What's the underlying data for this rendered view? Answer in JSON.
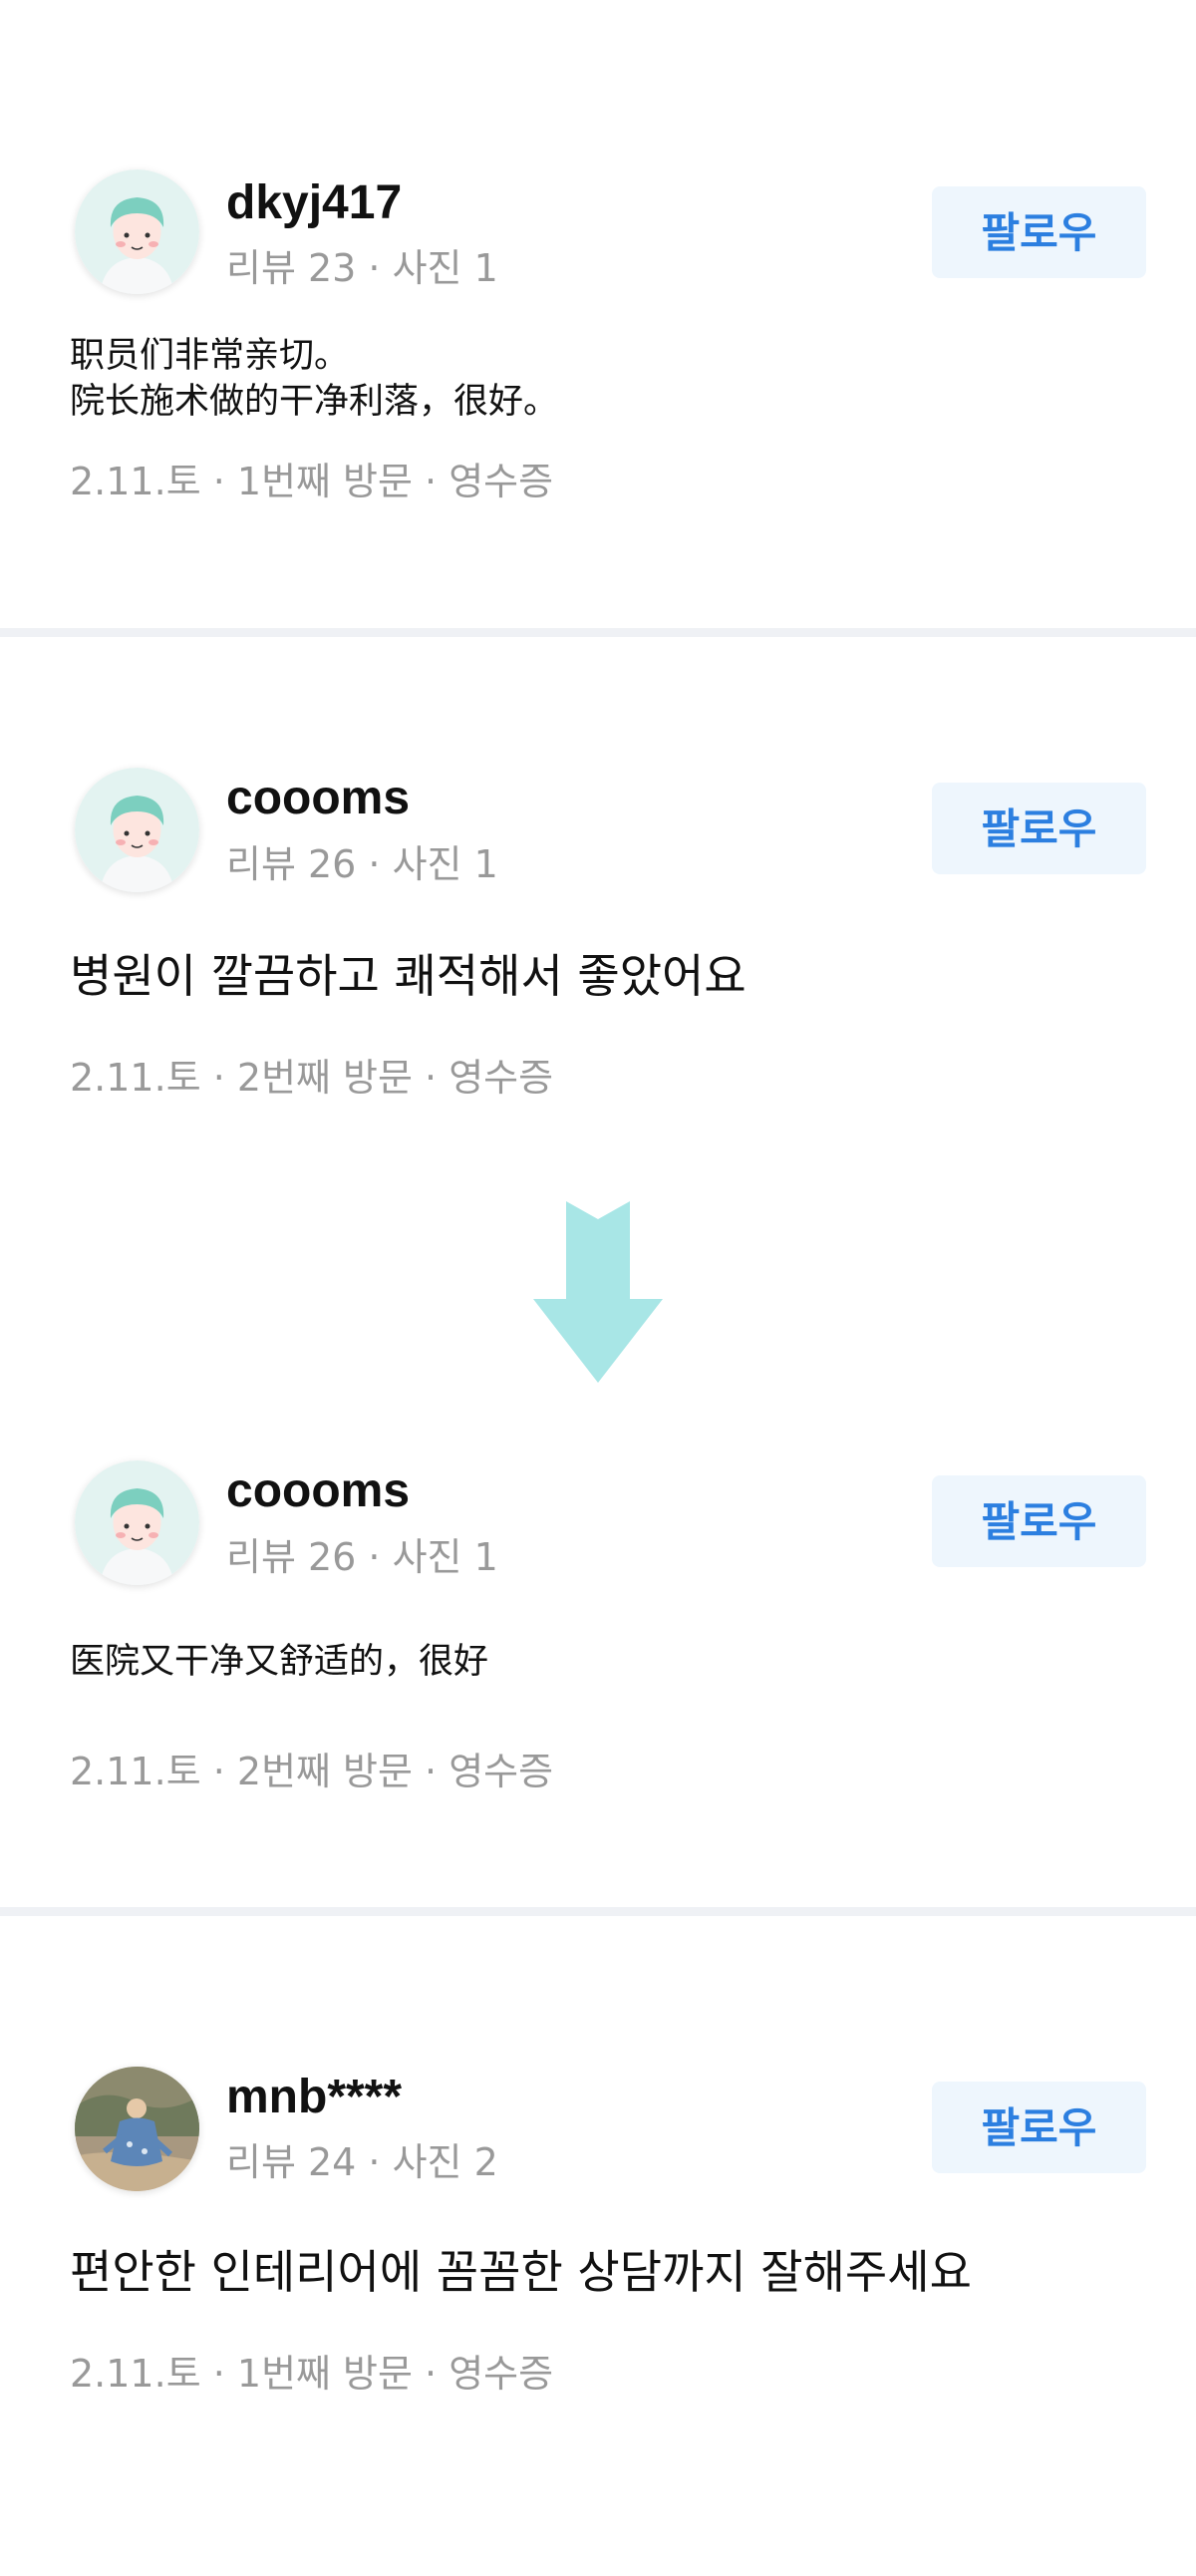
{
  "reviews": [
    {
      "username": "dkyj417",
      "stats": "리뷰 23 · 사진 1",
      "follow_label": "팔로우",
      "text": "职员们非常亲切。\n院长施术做的干净利落，很好。",
      "meta": "2.11.토 · 1번째 방문 · 영수증",
      "avatar": "default-avatar-icon"
    },
    {
      "username": "coooms",
      "stats": "리뷰 26 · 사진 1",
      "follow_label": "팔로우",
      "text": "병원이 깔끔하고 쾌적해서 좋았어요",
      "meta": "2.11.토 · 2번째 방문 · 영수증",
      "avatar": "default-avatar-icon"
    },
    {
      "username": "coooms",
      "stats": "리뷰 26 · 사진 1",
      "follow_label": "팔로우",
      "text": "医院又干净又舒适的，很好",
      "meta": "2.11.토 · 2번째 방문 · 영수증",
      "avatar": "default-avatar-icon"
    },
    {
      "username": "mnb****",
      "stats": "리뷰 24 · 사진 2",
      "follow_label": "팔로우",
      "text": "편안한 인테리어에 꼼꼼한 상담까지 잘해주세요",
      "meta": "2.11.토 · 1번째 방문 · 영수증",
      "avatar": "photo-avatar"
    }
  ],
  "colors": {
    "follow_text": "#2c7fe0",
    "follow_bg": "#eef6fd",
    "arrow": "#a8e6e6",
    "divider": "#eff1f5",
    "muted": "#999999"
  },
  "arrow_icon": "down-arrow-icon"
}
